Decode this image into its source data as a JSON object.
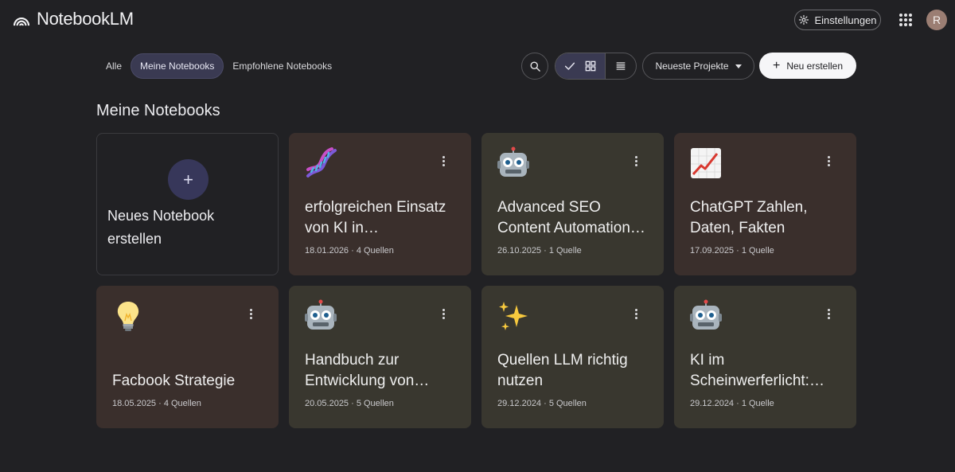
{
  "app": {
    "title": "NotebookLM"
  },
  "header": {
    "settings_label": "Einstellungen",
    "avatar_initial": "R"
  },
  "filters": {
    "tabs": [
      {
        "label": "Alle",
        "active": false
      },
      {
        "label": "Meine Notebooks",
        "active": true
      },
      {
        "label": "Empfohlene Notebooks",
        "active": false
      }
    ]
  },
  "toolbar": {
    "sort_label": "Neueste Projekte",
    "new_label": "Neu erstellen"
  },
  "section": {
    "title": "Meine Notebooks"
  },
  "new_notebook": {
    "label": "Neues Notebook erstellen"
  },
  "notebooks": [
    {
      "icon": "dna-icon",
      "title": "erfolgreichen Einsatz von KI in…",
      "meta": "18.01.2026 · 4 Quellen",
      "tone": "brown"
    },
    {
      "icon": "robot-icon",
      "title": "Advanced SEO Content Automation…",
      "meta": "26.10.2025 · 1 Quelle",
      "tone": "olive"
    },
    {
      "icon": "chart-increasing-icon",
      "title": "ChatGPT Zahlen, Daten, Fakten",
      "meta": "17.09.2025 · 1 Quelle",
      "tone": "brown"
    },
    {
      "icon": "light-bulb-icon",
      "title": "Facbook Strategie",
      "meta": "18.05.2025 · 4 Quellen",
      "tone": "brown"
    },
    {
      "icon": "robot-icon",
      "title": "Handbuch zur Entwicklung von…",
      "meta": "20.05.2025 · 5 Quellen",
      "tone": "olive"
    },
    {
      "icon": "sparkles-icon",
      "title": "Quellen LLM richtig nutzen",
      "meta": "29.12.2024 · 5 Quellen",
      "tone": "olive"
    },
    {
      "icon": "robot-icon",
      "title": "KI im Scheinwerferlicht:…",
      "meta": "29.12.2024 · 1 Quelle",
      "tone": "olive"
    }
  ],
  "colors": {
    "background": "#212124",
    "card_brown": "#3a2f2c",
    "card_olive": "#39372f",
    "active_tab": "#3a3a52",
    "primary_button": "#f6f6f8"
  }
}
